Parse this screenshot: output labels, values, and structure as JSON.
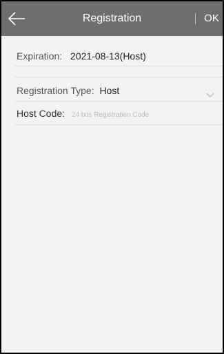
{
  "header": {
    "title": "Registration",
    "ok_label": "OK"
  },
  "expiration": {
    "label": "Expiration:",
    "value": "2021-08-13(Host)"
  },
  "registration_type": {
    "label": "Registration Type:",
    "value": "Host"
  },
  "host_code": {
    "label": "Host Code:",
    "placeholder": "24 bits Registration Code",
    "value": ""
  },
  "icons": {
    "back": "back-arrow-icon",
    "dropdown": "chevron-down-icon"
  },
  "colors": {
    "topbar": "#6e6e6e",
    "background": "#f3f3f3",
    "frame": "#000000"
  }
}
